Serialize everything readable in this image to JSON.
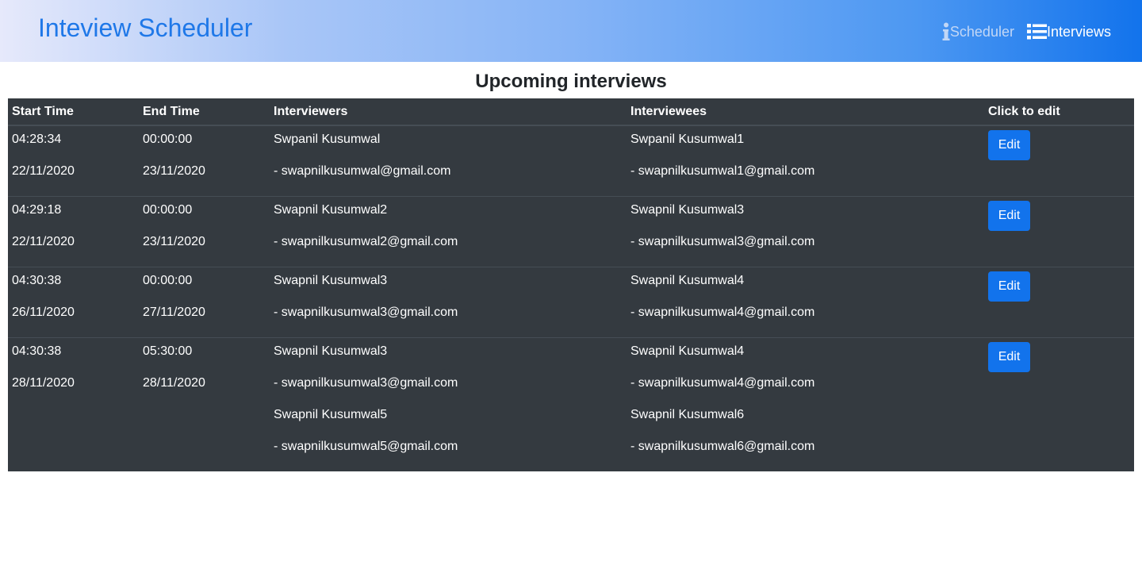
{
  "app": {
    "title": "Inteview Scheduler",
    "nav": [
      {
        "label": "Scheduler",
        "icon": "info-icon"
      },
      {
        "label": "Interviews",
        "icon": "list-icon"
      }
    ]
  },
  "page": {
    "heading": "Upcoming interviews"
  },
  "table": {
    "headers": [
      "Start Time",
      "End Time",
      "Interviewers",
      "Interviewees",
      "Click to edit"
    ],
    "rows": [
      {
        "start_time": "04:28:34",
        "start_date": "22/11/2020",
        "end_time": "00:00:00",
        "end_date": "23/11/2020",
        "interviewers": [
          {
            "name": "Swpanil Kusumwal",
            "email": "- swapnilkusumwal@gmail.com"
          }
        ],
        "interviewees": [
          {
            "name": "Swpanil Kusumwal1",
            "email": "- swapnilkusumwal1@gmail.com"
          }
        ],
        "action": "Edit"
      },
      {
        "start_time": "04:29:18",
        "start_date": "22/11/2020",
        "end_time": "00:00:00",
        "end_date": "23/11/2020",
        "interviewers": [
          {
            "name": "Swapnil Kusumwal2",
            "email": "- swapnilkusumwal2@gmail.com"
          }
        ],
        "interviewees": [
          {
            "name": "Swapnil Kusumwal3",
            "email": "- swapnilkusumwal3@gmail.com"
          }
        ],
        "action": "Edit"
      },
      {
        "start_time": "04:30:38",
        "start_date": "26/11/2020",
        "end_time": "00:00:00",
        "end_date": "27/11/2020",
        "interviewers": [
          {
            "name": "Swapnil Kusumwal3",
            "email": "- swapnilkusumwal3@gmail.com"
          }
        ],
        "interviewees": [
          {
            "name": "Swapnil Kusumwal4",
            "email": "- swapnilkusumwal4@gmail.com"
          }
        ],
        "action": "Edit"
      },
      {
        "start_time": "04:30:38",
        "start_date": "28/11/2020",
        "end_time": "05:30:00",
        "end_date": "28/11/2020",
        "interviewers": [
          {
            "name": "Swapnil Kusumwal3",
            "email": "- swapnilkusumwal3@gmail.com"
          },
          {
            "name": "Swapnil Kusumwal5",
            "email": "- swapnilkusumwal5@gmail.com"
          }
        ],
        "interviewees": [
          {
            "name": "Swapnil Kusumwal4",
            "email": "- swapnilkusumwal4@gmail.com"
          },
          {
            "name": "Swapnil Kusumwal6",
            "email": "- swapnilkusumwal6@gmail.com"
          }
        ],
        "action": "Edit"
      }
    ]
  },
  "colors": {
    "brand": "#1f78e8",
    "button": "#1273ec",
    "table_bg": "#343a40"
  }
}
